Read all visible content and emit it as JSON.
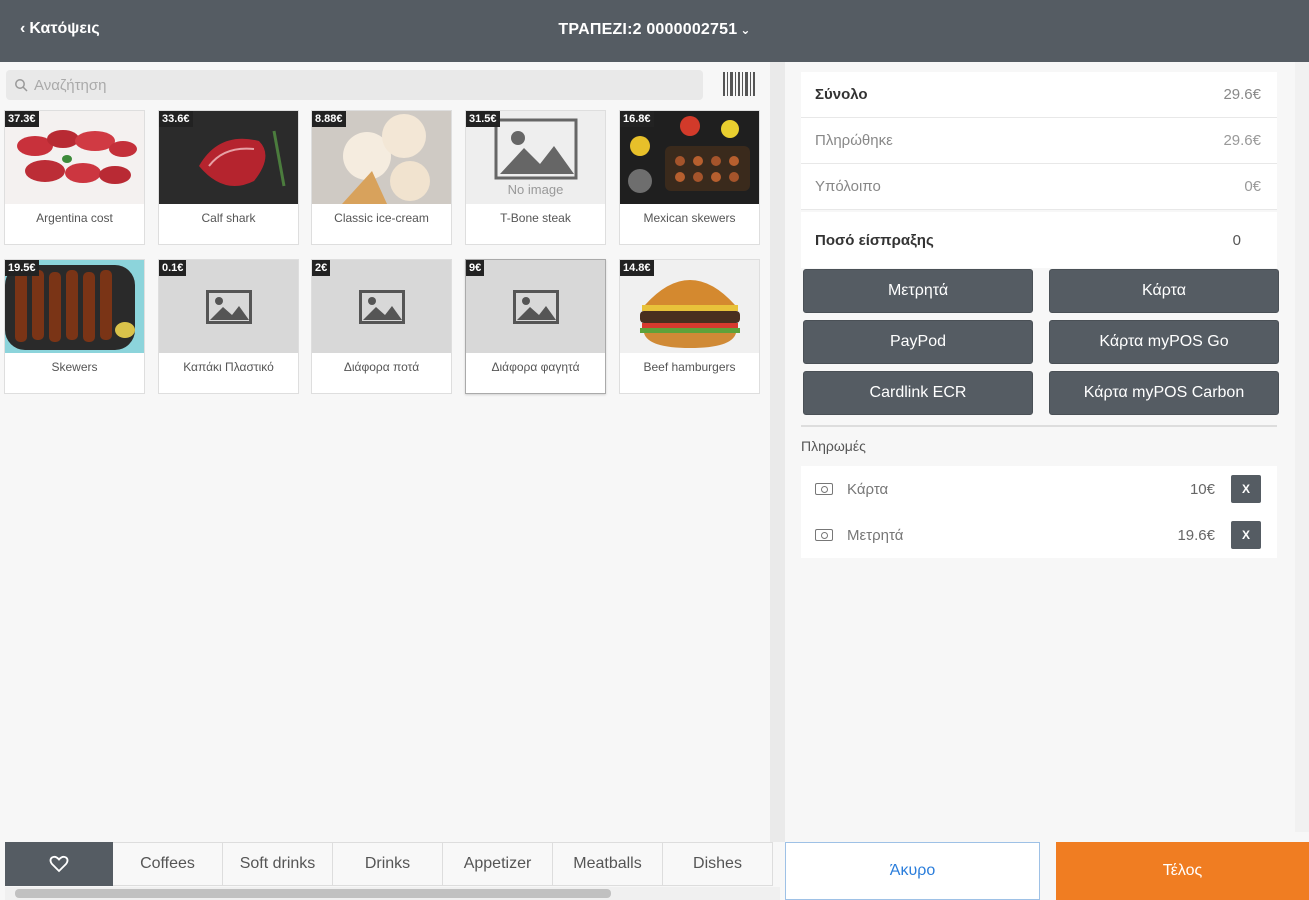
{
  "header": {
    "back_label": "Κατόψεις",
    "title": "ΤΡΑΠΕΖΙ:2 0000002751"
  },
  "search": {
    "placeholder": "Αναζήτηση"
  },
  "products": [
    {
      "price": "37.3€",
      "name": "Argentina cost",
      "image": "meat-steaks"
    },
    {
      "price": "33.6€",
      "name": "Calf shark",
      "image": "beef-steak"
    },
    {
      "price": "8.88€",
      "name": "Classic ice-cream",
      "image": "ice-cream"
    },
    {
      "price": "31.5€",
      "name": "T-Bone steak",
      "image": "no-image",
      "image_text": "No image"
    },
    {
      "price": "16.8€",
      "name": "Mexican skewers",
      "image": "mexican-skewers"
    },
    {
      "price": "19.5€",
      "name": "Skewers",
      "image": "skewers"
    },
    {
      "price": "0.1€",
      "name": "Καπάκι Πλαστικό",
      "image": "placeholder"
    },
    {
      "price": "2€",
      "name": "Διάφορα ποτά",
      "image": "placeholder"
    },
    {
      "price": "9€",
      "name": "Διάφορα φαγητά",
      "image": "placeholder"
    },
    {
      "price": "14.8€",
      "name": "Beef hamburgers",
      "image": "burger"
    }
  ],
  "categories": [
    "Coffees",
    "Soft drinks",
    "Drinks",
    "Appetizer",
    "Meatballs",
    "Dishes"
  ],
  "summary": {
    "total_label": "Σύνολο",
    "total_value": "29.6€",
    "paid_label": "Πληρώθηκε",
    "paid_value": "29.6€",
    "remaining_label": "Υπόλοιπο",
    "remaining_value": "0€",
    "collect_label": "Ποσό είσπραξης",
    "collect_value": "0"
  },
  "payment_methods": [
    "Μετρητά",
    "Κάρτα",
    "PayPod",
    "Κάρτα myPOS Go",
    "Cardlink ECR",
    "Κάρτα myPOS Carbon"
  ],
  "payments_label": "Πληρωμές",
  "payments": [
    {
      "method": "Κάρτα",
      "amount": "10€",
      "remove": "X"
    },
    {
      "method": "Μετρητά",
      "amount": "19.6€",
      "remove": "X"
    }
  ],
  "footer": {
    "cancel_label": "Άκυρο",
    "finish_label": "Τέλος"
  },
  "colors": {
    "header_bg": "#555c63",
    "accent_orange": "#f07d22",
    "cancel_text": "#2a7ddb"
  }
}
